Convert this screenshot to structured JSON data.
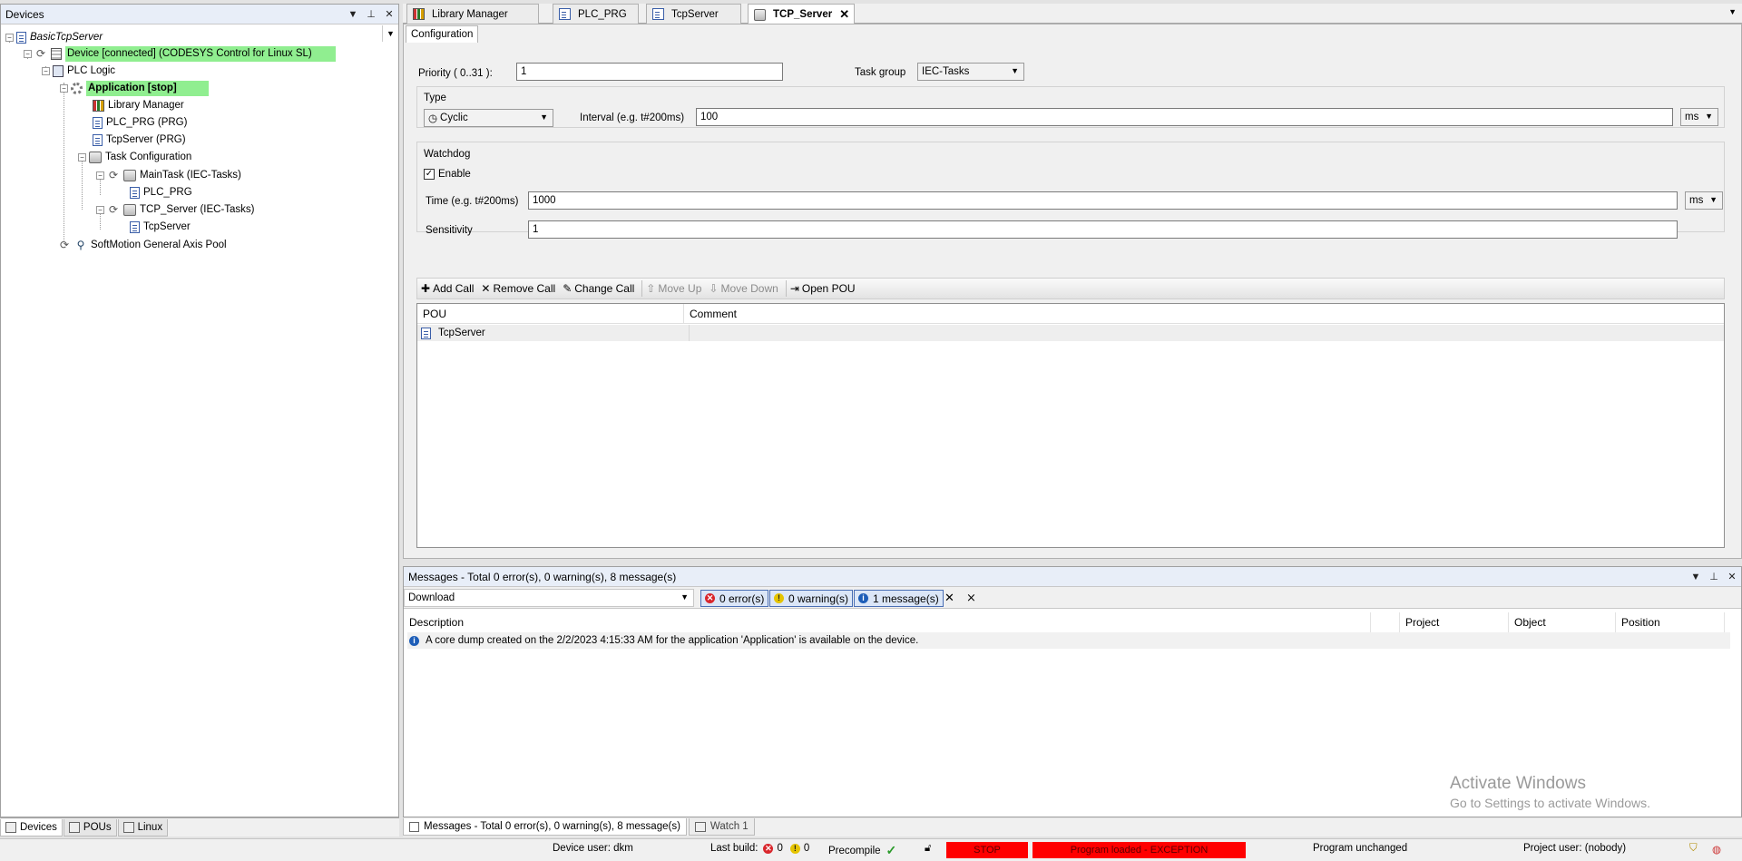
{
  "devices_panel": {
    "title": "Devices",
    "tree": {
      "project": "BasicTcpServer",
      "device": "Device [connected] (CODESYS Control for Linux SL)",
      "plc_logic": "PLC Logic",
      "application": "Application [stop]",
      "library_manager": "Library Manager",
      "plc_prg": "PLC_PRG (PRG)",
      "tcpserver": "TcpServer (PRG)",
      "task_configuration": "Task Configuration",
      "maintask": "MainTask (IEC-Tasks)",
      "maintask_call": "PLC_PRG",
      "tcp_server_task": "TCP_Server (IEC-Tasks)",
      "tcp_server_call": "TcpServer",
      "softmotion": "SoftMotion General Axis Pool"
    },
    "bottom_tabs": [
      "Devices",
      "POUs",
      "Linux"
    ],
    "highlight_color": "#90ee90"
  },
  "editor_tabs": [
    "Library Manager",
    "PLC_PRG",
    "TcpServer",
    "TCP_Server"
  ],
  "editor": {
    "subtab": "Configuration",
    "priority_label": "Priority ( 0..31 ):",
    "priority_value": "1",
    "task_group_label": "Task group",
    "task_group_value": "IEC-Tasks",
    "type_group": "Type",
    "type_value": "Cyclic",
    "interval_label": "Interval (e.g. t#200ms)",
    "interval_value": "100",
    "interval_unit": "ms",
    "watchdog_group": "Watchdog",
    "enable_label": "Enable",
    "enable_checked": true,
    "time_label": "Time (e.g. t#200ms)",
    "time_value": "1000",
    "time_unit": "ms",
    "sensitivity_label": "Sensitivity",
    "sensitivity_value": "1",
    "toolbar": {
      "add_call": "Add Call",
      "remove_call": "Remove Call",
      "change_call": "Change Call",
      "move_up": "Move Up",
      "move_down": "Move Down",
      "open_pou": "Open POU"
    },
    "table": {
      "columns": [
        "POU",
        "Comment"
      ],
      "rows": [
        {
          "pou": "TcpServer",
          "comment": ""
        }
      ]
    }
  },
  "messages": {
    "title": "Messages - Total 0 error(s), 0 warning(s), 8 message(s)",
    "category": "Download",
    "errors": "0 error(s)",
    "warnings": "0 warning(s)",
    "infos": "1 message(s)",
    "columns": [
      "Description",
      "Project",
      "Object",
      "Position"
    ],
    "rows": [
      {
        "description": "A core dump created on the 2/2/2023 4:15:33 AM for the application 'Application' is available on the device.",
        "project": "",
        "object": "",
        "position": ""
      }
    ],
    "watermark_title": "Activate Windows",
    "watermark_sub": "Go to Settings to activate Windows."
  },
  "message_tabs": [
    "Messages - Total 0 error(s), 0 warning(s), 8 message(s)",
    "Watch 1"
  ],
  "statusbar": {
    "device_user": "Device user: dkm",
    "last_build": "Last build:",
    "errors": "0",
    "warnings": "0",
    "precompile": "Precompile",
    "stop": "STOP",
    "program_state": "Program loaded - EXCEPTION",
    "program_unchanged": "Program unchanged",
    "project_user": "Project user: (nobody)",
    "alert_color": "#ff0000"
  }
}
